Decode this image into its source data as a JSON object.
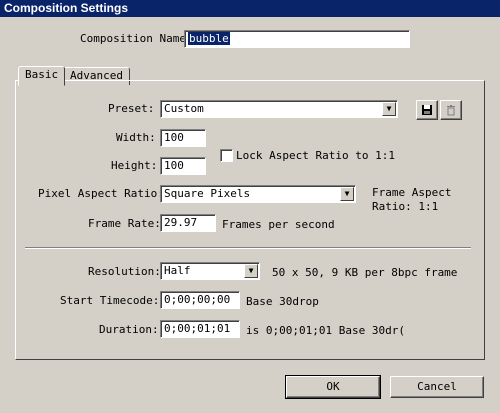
{
  "window": {
    "title": "Composition Settings"
  },
  "composition_name": {
    "label": "Composition Name:",
    "value": "bubble"
  },
  "tabs": [
    {
      "label": "Basic"
    },
    {
      "label": "Advanced"
    }
  ],
  "preset": {
    "label": "Preset:",
    "value": "Custom"
  },
  "width": {
    "label": "Width:",
    "value": "100"
  },
  "height": {
    "label": "Height:",
    "value": "100"
  },
  "lock_aspect": {
    "label": "Lock Aspect Ratio to 1:1",
    "checked": false
  },
  "pixel_aspect": {
    "label": "Pixel Aspect Ratio:",
    "value": "Square Pixels"
  },
  "frame_aspect": {
    "line1": "Frame Aspect",
    "line2": "Ratio: 1:1"
  },
  "frame_rate": {
    "label": "Frame Rate:",
    "value": "29.97",
    "unit": "Frames per second"
  },
  "resolution": {
    "label": "Resolution:",
    "value": "Half",
    "info": "50 x 50, 9 KB per 8bpc frame"
  },
  "start_timecode": {
    "label": "Start Timecode:",
    "value": "0;00;00;00",
    "note": "Base 30drop"
  },
  "duration": {
    "label": "Duration:",
    "value": "0;00;01;01",
    "note": "is 0;00;01;01  Base 30dr("
  },
  "buttons": {
    "ok": "OK",
    "cancel": "Cancel"
  },
  "icons": {
    "save": "save-icon",
    "delete": "trash-icon",
    "dropdown": "chevron-down-icon"
  }
}
